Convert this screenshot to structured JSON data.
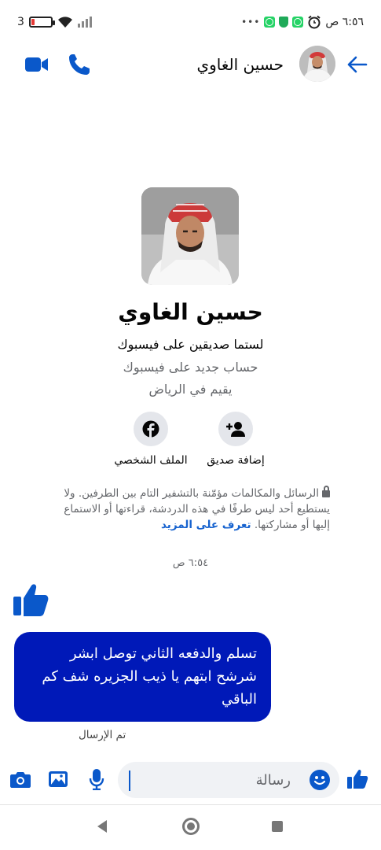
{
  "status_bar": {
    "time": "٦:٥٦ ص",
    "battery_text": "3",
    "battery_level": 0.15
  },
  "header": {
    "contact_name": "حسين الغاوي",
    "icons": [
      "back-arrow-icon",
      "video-call-icon",
      "phone-call-icon"
    ]
  },
  "profile": {
    "name": "حسين الغاوي",
    "friendship_status": "لستما صديقين على فيسبوك",
    "account_note": "حساب جديد على فيسبوك",
    "location": "يقيم في الرياض",
    "actions": {
      "add_friend": "إضافة صديق",
      "view_profile": "الملف الشخصي"
    }
  },
  "encryption": {
    "line1": "الرسائل والمكالمات مؤمّنة بالتشفير التام بين الطرفين.",
    "line2": "ولا يستطيع أحد ليس طرفًا في هذه الدردشة، قراءتها أو الاستماع إليها أو مشاركتها.",
    "learn_more": "تعرف على المزيد"
  },
  "conversation": {
    "timestamp": "٦:٥٤ ص",
    "message_text": "تسلم والدفعه الثاني توصل ابشر شرشح ابتهم يا ذيب الجزيره شف كم الباقي",
    "sent_status": "تم الإرسال"
  },
  "composer": {
    "placeholder": "رسالة"
  },
  "colors": {
    "messenger_blue": "#0a58ca",
    "bubble_blue": "#0019b8",
    "secondary_text": "#65676b",
    "link_blue": "#1763cf"
  }
}
